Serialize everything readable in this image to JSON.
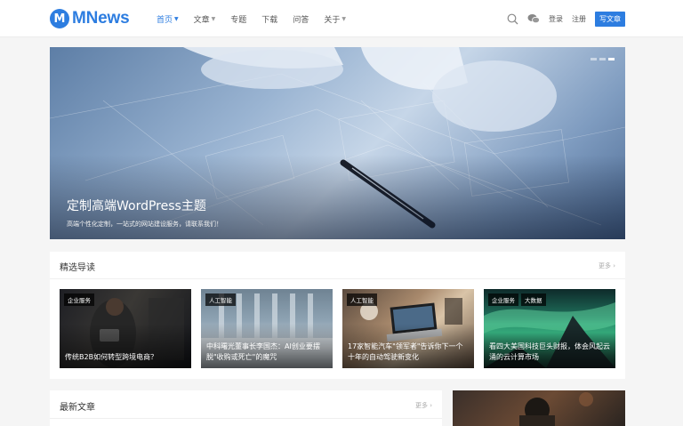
{
  "header": {
    "logo_mark": "M",
    "logo_text": "MNews",
    "nav": [
      {
        "label": "首页",
        "has_caret": true,
        "active": true
      },
      {
        "label": "文章",
        "has_caret": true,
        "active": false
      },
      {
        "label": "专题",
        "has_caret": false,
        "active": false
      },
      {
        "label": "下载",
        "has_caret": false,
        "active": false
      },
      {
        "label": "问答",
        "has_caret": false,
        "active": false
      },
      {
        "label": "关于",
        "has_caret": true,
        "active": false
      }
    ],
    "icons": [
      "search-icon",
      "wechat-icon"
    ],
    "login": "登录",
    "register": "注册",
    "write": "写文章",
    "accent": "#2d7de0"
  },
  "hero": {
    "title": "定制高端WordPress主题",
    "subtitle": "高端个性化定制，一站式的网站建设服务，请联系我们！",
    "slide_count": 3,
    "active_slide": 3
  },
  "featured": {
    "heading": "精选导读",
    "more": "更多",
    "cards": [
      {
        "tags": [
          "企业服务"
        ],
        "title": "传统B2B如何转型跨境电商？"
      },
      {
        "tags": [
          "人工智能"
        ],
        "title": "中科曙光董事长李国杰：AI创业要摆脱\"收购或死亡\"的魔咒"
      },
      {
        "tags": [
          "人工智能"
        ],
        "title": "17家智能汽车\"领军者\"告诉你下一个十年的自动驾驶新变化"
      },
      {
        "tags": [
          "企业服务",
          "大数据"
        ],
        "title": "看四大美国科技巨头财报，体会风起云涌的云计算市场"
      }
    ]
  },
  "latest": {
    "heading": "最新文章",
    "more": "更多"
  }
}
